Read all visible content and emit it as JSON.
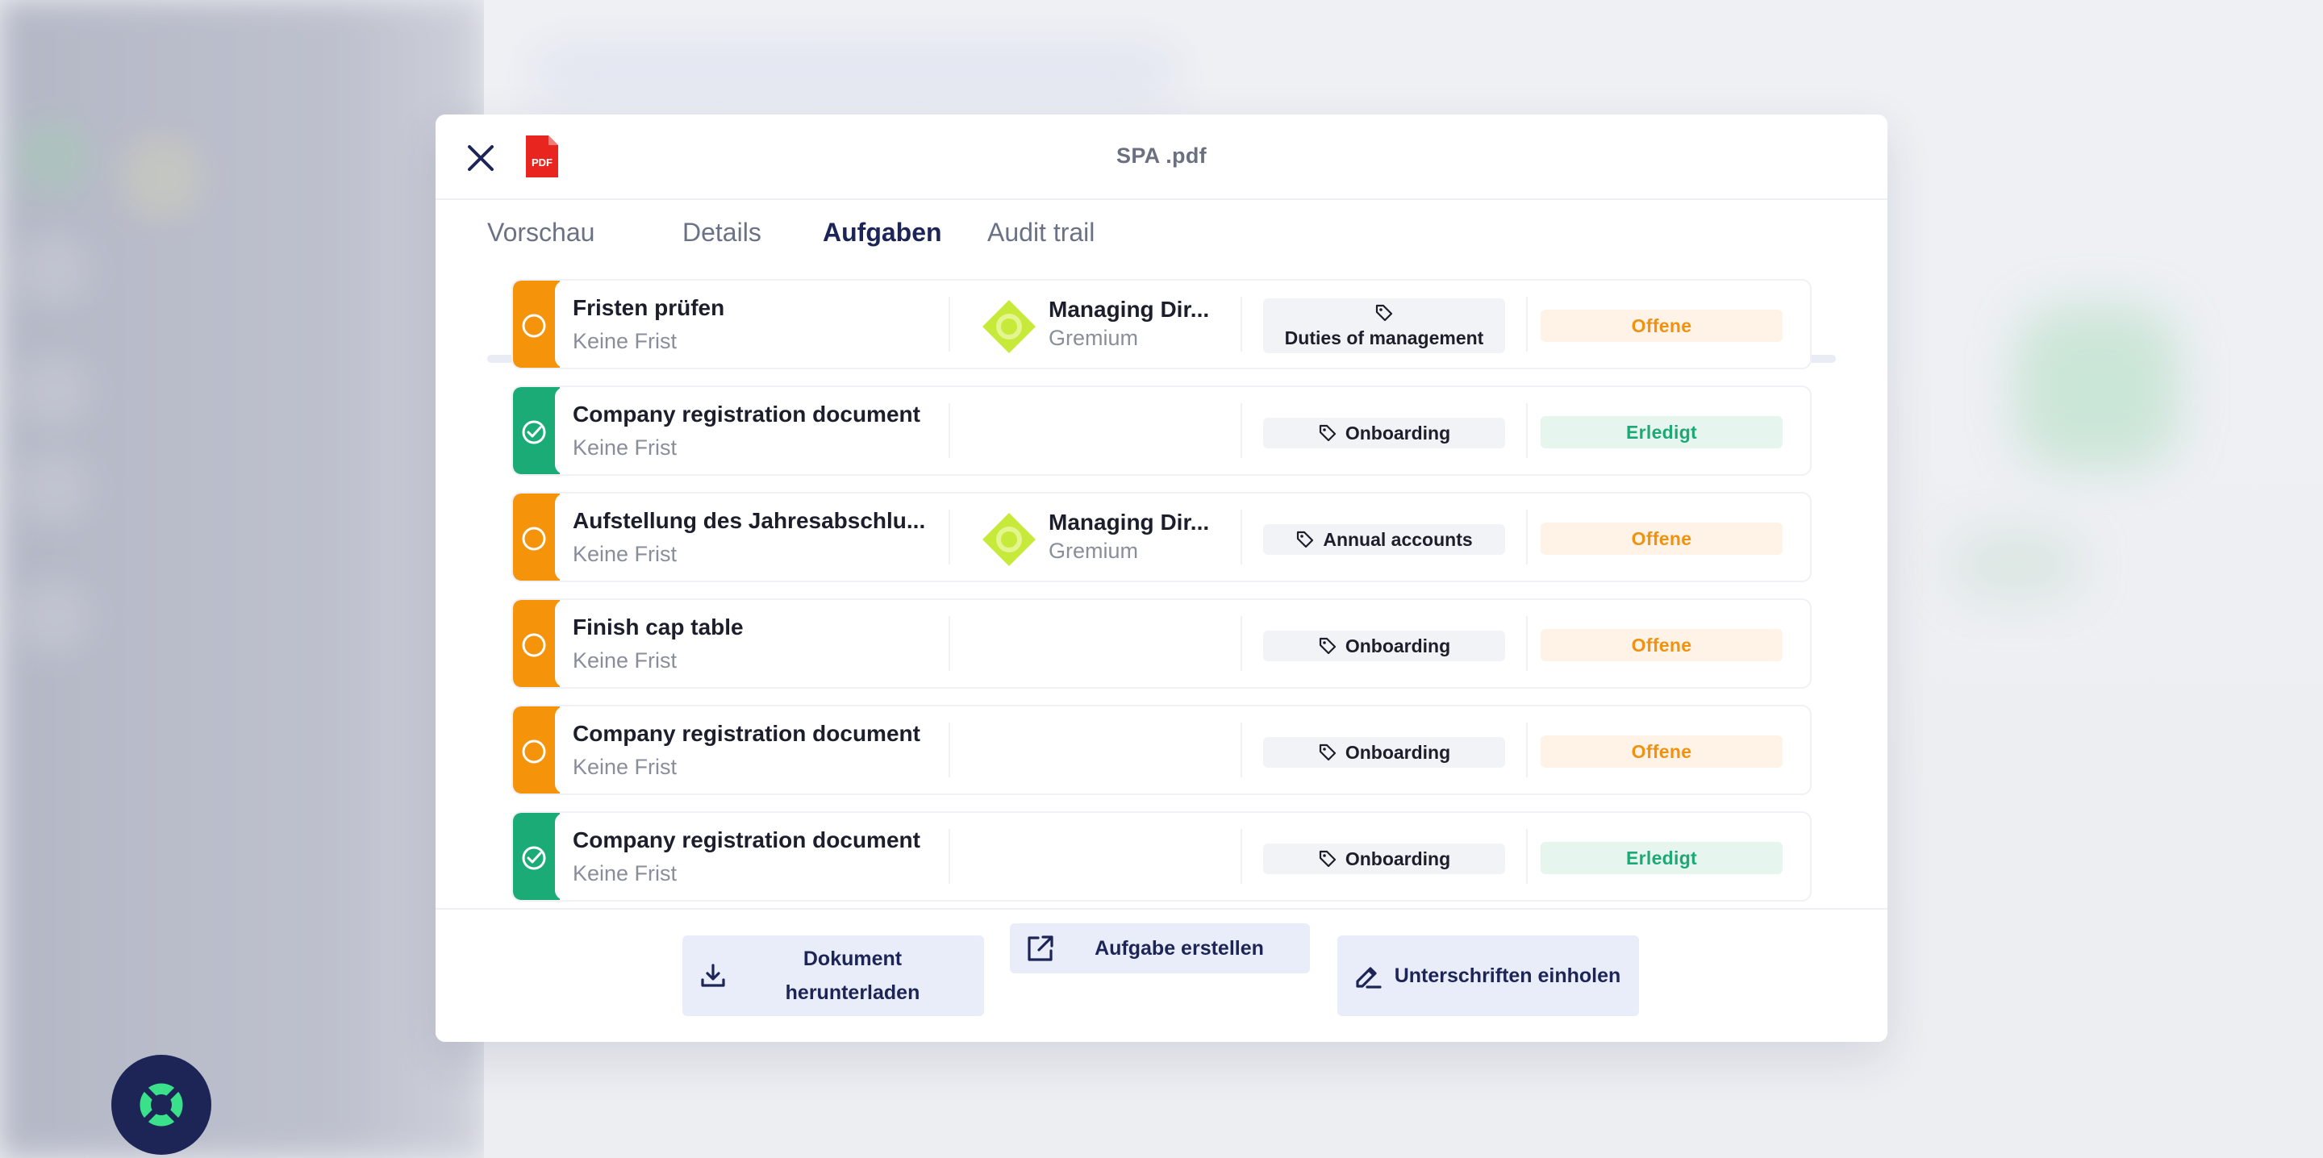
{
  "modal": {
    "title": "SPA .pdf",
    "file_type_label": "PDF"
  },
  "tabs": [
    {
      "label": "Vorschau",
      "active": false
    },
    {
      "label": "Details",
      "active": false
    },
    {
      "label": "Aufgaben",
      "active": true
    },
    {
      "label": "Audit trail",
      "active": false
    }
  ],
  "tasks": [
    {
      "title": "Fristen prüfen",
      "deadline": "Keine Frist",
      "status": "open",
      "assignee": {
        "name": "Managing Dir...",
        "role": "Gremium"
      },
      "tag": "Duties of management",
      "badge": "Offene"
    },
    {
      "title": "Company registration document",
      "deadline": "Keine Frist",
      "status": "done",
      "assignee": null,
      "tag": "Onboarding",
      "badge": "Erledigt"
    },
    {
      "title": "Aufstellung des Jahresabschlu...",
      "deadline": "Keine Frist",
      "status": "open",
      "assignee": {
        "name": "Managing Dir...",
        "role": "Gremium"
      },
      "tag": "Annual accounts",
      "badge": "Offene"
    },
    {
      "title": "Finish cap table",
      "deadline": "Keine Frist",
      "status": "open",
      "assignee": null,
      "tag": "Onboarding",
      "badge": "Offene"
    },
    {
      "title": "Company registration document",
      "deadline": "Keine Frist",
      "status": "open",
      "assignee": null,
      "tag": "Onboarding",
      "badge": "Offene"
    },
    {
      "title": "Company registration document",
      "deadline": "Keine Frist",
      "status": "done",
      "assignee": null,
      "tag": "Onboarding",
      "badge": "Erledigt"
    }
  ],
  "footer": {
    "download_label": "Dokument herunterladen",
    "create_task_label": "Aufgabe erstellen",
    "signatures_label": "Unterschriften einholen"
  },
  "colors": {
    "primary": "#1c2556",
    "open": "#f5930b",
    "done": "#1bab77",
    "pdf_red": "#e8251e",
    "avatar_lime": "#c6e93a",
    "help_green": "#3be08a"
  },
  "icons": {
    "close": "close-icon",
    "pdf": "pdf-file-icon",
    "open_status": "circle-icon",
    "done_status": "check-circle-icon",
    "tag": "tag-icon",
    "download": "download-icon",
    "external": "open-external-icon",
    "sign": "signature-pen-icon",
    "help": "lifebuoy-icon"
  }
}
